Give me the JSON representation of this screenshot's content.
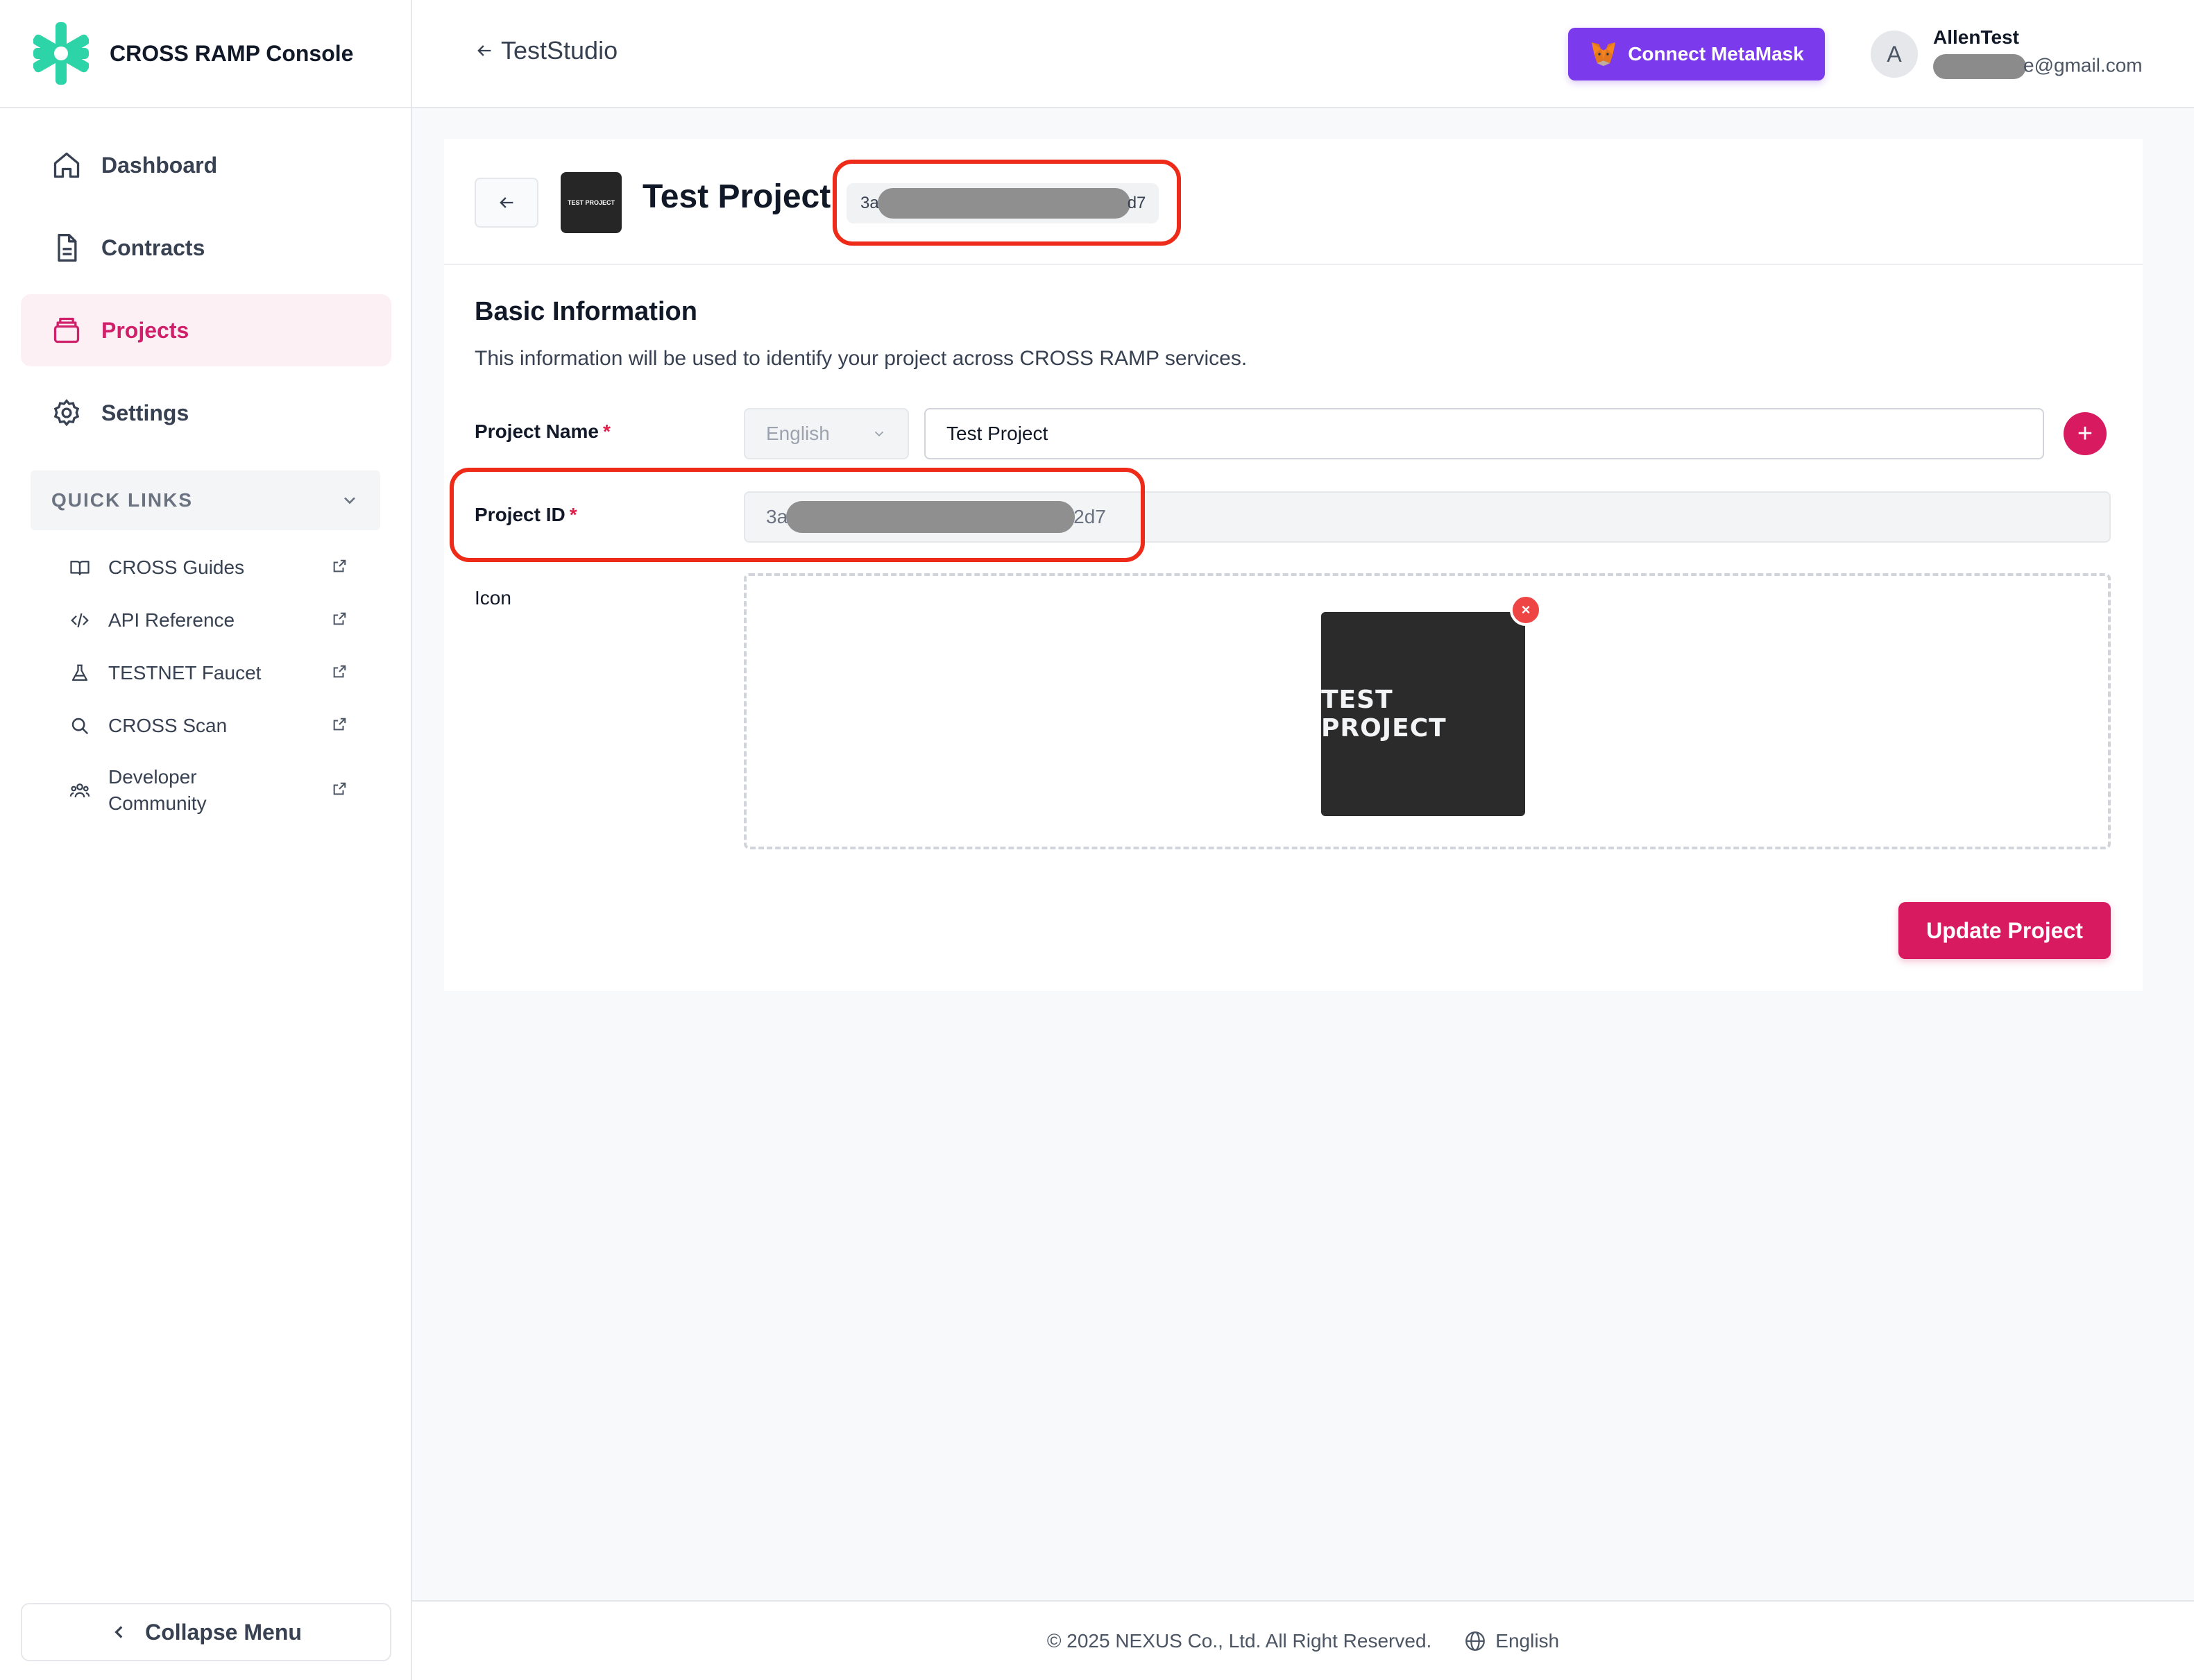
{
  "app": {
    "title": "CROSS RAMP Console"
  },
  "sidebar": {
    "nav": [
      {
        "label": "Dashboard",
        "icon": "home-icon"
      },
      {
        "label": "Contracts",
        "icon": "document-icon"
      },
      {
        "label": "Projects",
        "icon": "projects-icon",
        "active": true
      },
      {
        "label": "Settings",
        "icon": "gear-icon"
      }
    ],
    "quick_links_title": "QUICK LINKS",
    "quick_links": [
      {
        "label": "CROSS Guides",
        "icon": "book-icon"
      },
      {
        "label": "API Reference",
        "icon": "code-icon"
      },
      {
        "label": "TESTNET Faucet",
        "icon": "flask-icon"
      },
      {
        "label": "CROSS Scan",
        "icon": "search-icon"
      },
      {
        "label": "Developer Community",
        "icon": "community-icon"
      }
    ],
    "collapse_label": "Collapse Menu"
  },
  "topbar": {
    "breadcrumb": "TestStudio",
    "connect_label": "Connect MetaMask",
    "user": {
      "initial": "A",
      "name": "AllenTest",
      "email_prefix_visible": "e",
      "email_domain": "@gmail.com"
    }
  },
  "project": {
    "title": "Test Project",
    "thumb_text": "TEST PROJECT",
    "id_prefix": "3a",
    "id_suffix_header": "d7",
    "id_input_prefix": "3a",
    "id_input_suffix": "2d7"
  },
  "form": {
    "section_title": "Basic Information",
    "section_desc": "This information will be used to identify your project across CROSS RAMP services.",
    "name_label": "Project Name",
    "required_mark": "*",
    "language_selected": "English",
    "name_value": "Test Project",
    "add_symbol": "+",
    "id_label": "Project ID",
    "icon_label": "Icon",
    "icon_preview_text": "TEST PROJECT",
    "remove_symbol": "×",
    "update_label": "Update Project"
  },
  "footer": {
    "copyright": "© 2025 NEXUS Co., Ltd. All Right Reserved.",
    "language": "English"
  },
  "colors": {
    "accent": "#d81b60",
    "metamask": "#7c3aed",
    "highlight": "#ee2a18",
    "brand_green": "#2dd4a8"
  }
}
